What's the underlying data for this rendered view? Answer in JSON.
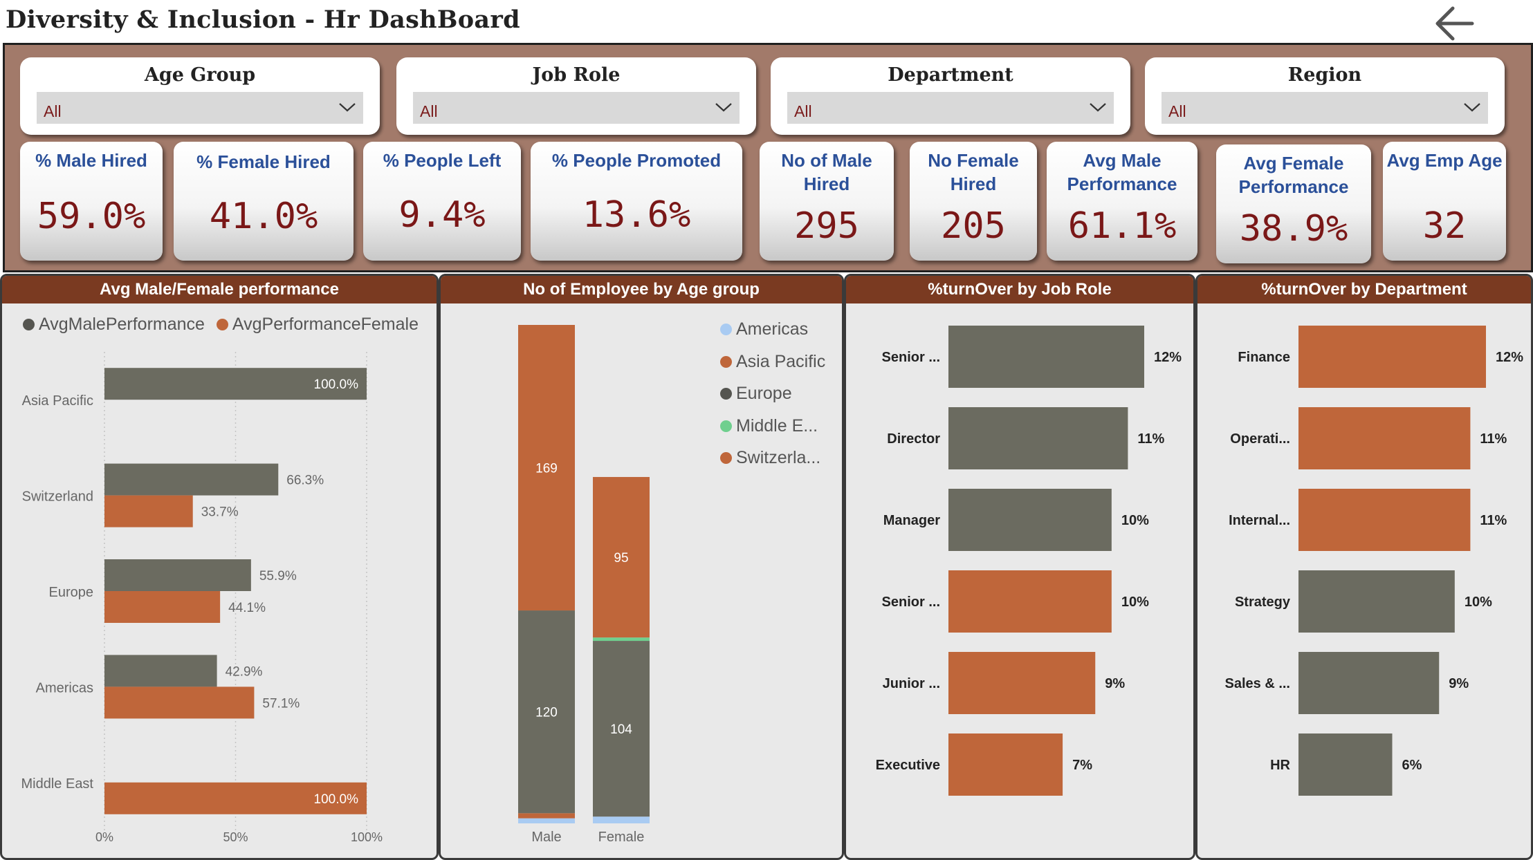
{
  "title": "Diversity & Inclusion - Hr DashBoard",
  "back_icon": "back-arrow-icon",
  "colors": {
    "male": "#6b6b60",
    "female": "#bf663a",
    "americas": "#a9cbf2",
    "middle_east": "#6fcf8e",
    "header": "#7a3a21",
    "kpi_value": "#7a1717",
    "kpi_label": "#2b5099"
  },
  "slicers": [
    {
      "label": "Age Group",
      "value": "All"
    },
    {
      "label": "Job Role",
      "value": "All"
    },
    {
      "label": "Department",
      "value": "All"
    },
    {
      "label": "Region",
      "value": "All"
    }
  ],
  "kpis": [
    {
      "label": "% Male Hired",
      "value": "59.0%"
    },
    {
      "label": "% Female Hired",
      "value": "41.0%"
    },
    {
      "label": "% People Left",
      "value": "9.4%"
    },
    {
      "label": "% People Promoted",
      "value": "13.6%"
    },
    {
      "label": "No of Male Hired",
      "value": "295"
    },
    {
      "label": "No Female Hired",
      "value": "205"
    },
    {
      "label": "Avg Male Performance",
      "value": "61.1%"
    },
    {
      "label": "Avg Female Performance",
      "value": "38.9%"
    },
    {
      "label": "Avg Emp Age",
      "value": "32"
    }
  ],
  "chart_data": [
    {
      "type": "bar",
      "orientation": "horizontal",
      "title": "Avg Male/Female performance",
      "categories": [
        "Asia Pacific",
        "Switzerland",
        "Europe",
        "Americas",
        "Middle East"
      ],
      "series": [
        {
          "name": "AvgMalePerformance",
          "values": [
            100.0,
            66.3,
            55.9,
            42.9,
            null
          ],
          "labels": [
            "100.0%",
            "66.3%",
            "55.9%",
            "42.9%",
            ""
          ]
        },
        {
          "name": "AvgPerformanceFemale",
          "values": [
            null,
            33.7,
            44.1,
            57.1,
            100.0
          ],
          "labels": [
            "",
            "33.7%",
            "44.1%",
            "57.1%",
            "100.0%"
          ]
        }
      ],
      "xlim": [
        0,
        100
      ],
      "xticks": [
        "0%",
        "50%",
        "100%"
      ],
      "grid": true,
      "legend": "top-left"
    },
    {
      "type": "bar",
      "stacked": true,
      "title": "No of Employee by Age group",
      "categories": [
        "Male",
        "Female"
      ],
      "series": [
        {
          "name": "Americas",
          "values": [
            3,
            4
          ]
        },
        {
          "name": "Asia Pacific",
          "values": [
            3,
            0
          ]
        },
        {
          "name": "Europe",
          "values": [
            120,
            104
          ]
        },
        {
          "name": "Middle E...",
          "values": [
            0,
            2
          ]
        },
        {
          "name": "Switzerla...",
          "values": [
            169,
            95
          ]
        }
      ],
      "segment_labels": [
        [
          "",
          "",
          "120",
          "",
          "169"
        ],
        [
          "",
          "",
          "104",
          "",
          "95"
        ]
      ],
      "legend": "top-right"
    },
    {
      "type": "bar",
      "orientation": "horizontal",
      "title": "%turnOver by Job Role",
      "categories": [
        "Senior ...",
        "Director",
        "Manager",
        "Senior ...",
        "Junior ...",
        "Executive"
      ],
      "values": [
        12,
        11,
        10,
        10,
        9,
        7
      ],
      "labels": [
        "12%",
        "11%",
        "10%",
        "10%",
        "9%",
        "7%"
      ],
      "bar_colors": [
        "male",
        "male",
        "male",
        "female",
        "female",
        "female"
      ],
      "xlim": [
        0,
        12
      ]
    },
    {
      "type": "bar",
      "orientation": "horizontal",
      "title": "%turnOver by Department",
      "categories": [
        "Finance",
        "Operati...",
        "Internal...",
        "Strategy",
        "Sales & ...",
        "HR"
      ],
      "values": [
        12,
        11,
        11,
        10,
        9,
        6
      ],
      "labels": [
        "12%",
        "11%",
        "11%",
        "10%",
        "9%",
        "6%"
      ],
      "bar_colors": [
        "female",
        "female",
        "female",
        "male",
        "male",
        "male"
      ],
      "xlim": [
        0,
        12
      ]
    }
  ]
}
